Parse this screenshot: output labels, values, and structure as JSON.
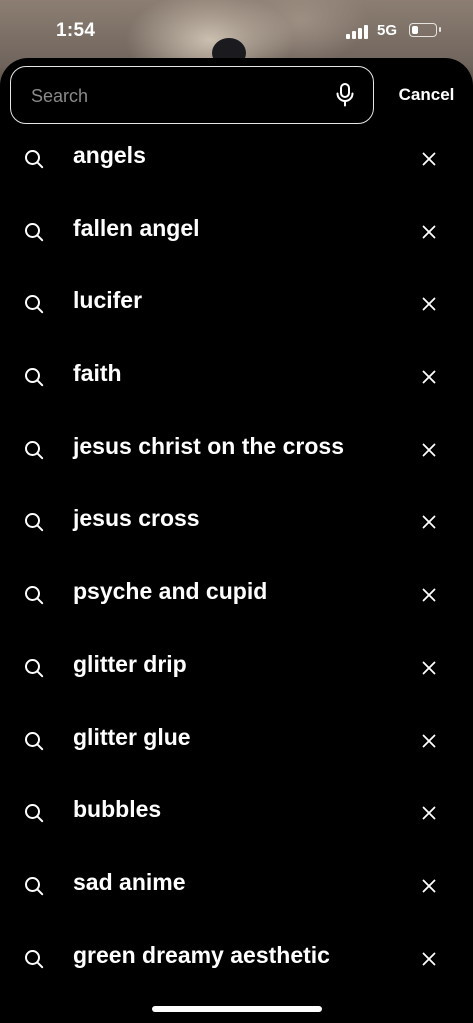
{
  "status_bar": {
    "time": "1:54",
    "network": "5G",
    "signal_bars": 4,
    "battery_level": 0.3
  },
  "search": {
    "placeholder": "Search",
    "value": "",
    "mic_icon": "microphone-icon",
    "cancel_label": "Cancel"
  },
  "history": {
    "item_icon": "search-icon",
    "remove_icon": "close-icon",
    "items": [
      {
        "label": "angels"
      },
      {
        "label": "fallen angel"
      },
      {
        "label": "lucifer"
      },
      {
        "label": "faith"
      },
      {
        "label": "jesus christ on the cross"
      },
      {
        "label": "jesus cross"
      },
      {
        "label": "psyche and cupid"
      },
      {
        "label": "glitter drip"
      },
      {
        "label": "glitter glue"
      },
      {
        "label": "bubbles"
      },
      {
        "label": "sad anime"
      },
      {
        "label": "green dreamy aesthetic"
      }
    ]
  },
  "colors": {
    "background": "#000000",
    "text": "#ffffff",
    "placeholder": "#8a8a8a",
    "search_border": "#e6e6e6"
  }
}
